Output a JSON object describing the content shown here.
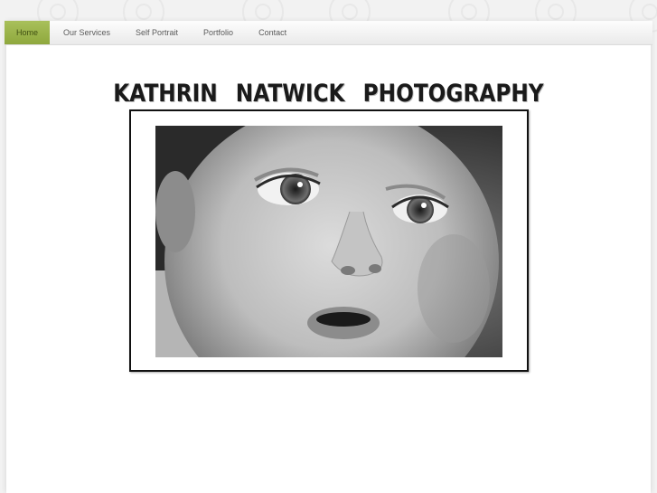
{
  "nav": {
    "items": [
      {
        "label": "Home",
        "active": true
      },
      {
        "label": "Our Services",
        "active": false
      },
      {
        "label": "Self Portrait",
        "active": false
      },
      {
        "label": "Portfolio",
        "active": false
      },
      {
        "label": "Contact",
        "active": false
      }
    ]
  },
  "header": {
    "title": "Kathrin Natwick Photography"
  },
  "hero": {
    "image": "black-and-white portrait of a baby's face"
  },
  "colors": {
    "accent": "#9bb24a",
    "frame_border": "#111111",
    "background": "#f2f2f2",
    "panel": "#ffffff"
  }
}
